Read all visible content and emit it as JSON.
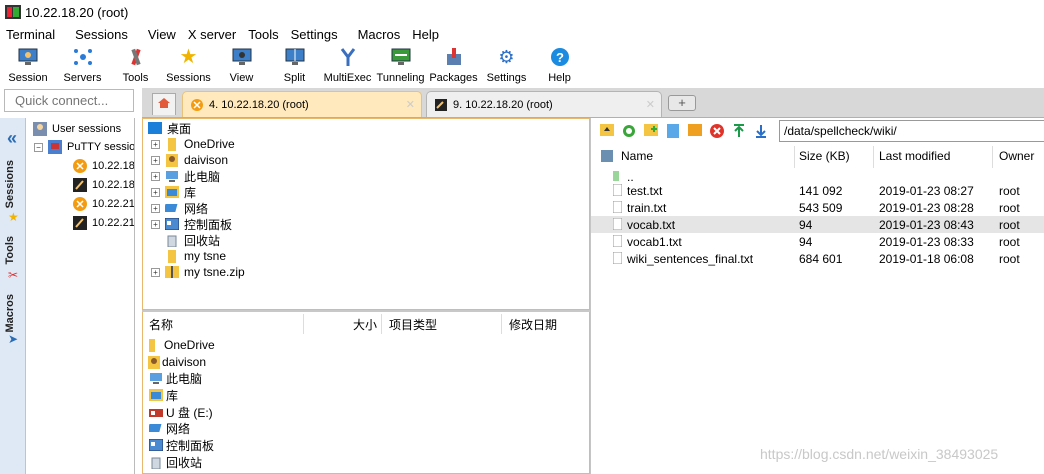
{
  "window": {
    "title": "10.22.18.20 (root)"
  },
  "menu": [
    "Terminal",
    "Sessions",
    "View",
    "X server",
    "Tools",
    "Settings",
    "Macros",
    "Help"
  ],
  "toolbar": [
    {
      "label": "Session",
      "icon": "monitor-session-icon"
    },
    {
      "label": "Servers",
      "icon": "servers-icon"
    },
    {
      "label": "Tools",
      "icon": "tools-icon"
    },
    {
      "label": "Sessions",
      "icon": "star-icon"
    },
    {
      "label": "View",
      "icon": "view-icon"
    },
    {
      "label": "Split",
      "icon": "split-icon"
    },
    {
      "label": "MultiExec",
      "icon": "fork-icon"
    },
    {
      "label": "Tunneling",
      "icon": "tunneling-icon"
    },
    {
      "label": "Packages",
      "icon": "packages-icon"
    },
    {
      "label": "Settings",
      "icon": "gear-icon"
    },
    {
      "label": "Help",
      "icon": "help-icon"
    }
  ],
  "quick_connect": {
    "placeholder": "Quick connect..."
  },
  "tabs": [
    {
      "label": "4. 10.22.18.20 (root)",
      "active": true
    },
    {
      "label": "9. 10.22.18.20 (root)",
      "active": false
    }
  ],
  "sidebar": {
    "sessions_label": "Sessions",
    "tools_label": "Tools",
    "macros_label": "Macros"
  },
  "sessions_panel": {
    "root": "User sessions",
    "group": "PuTTY sessio",
    "items": [
      "10.22.18",
      "10.22.18",
      "10.22.21",
      "10.22.21"
    ]
  },
  "local_tree": {
    "root": "桌面",
    "items": [
      {
        "label": "OneDrive",
        "expander": "+"
      },
      {
        "label": "daivison",
        "expander": "+"
      },
      {
        "label": "此电脑",
        "expander": "+"
      },
      {
        "label": "库",
        "expander": "+"
      },
      {
        "label": "网络",
        "expander": "+"
      },
      {
        "label": "控制面板",
        "expander": "+"
      },
      {
        "label": "回收站",
        "expander": ""
      },
      {
        "label": "my tsne",
        "expander": ""
      },
      {
        "label": "my tsne.zip",
        "expander": "+"
      }
    ]
  },
  "local_list": {
    "headers": [
      "名称",
      "大小",
      "项目类型",
      "修改日期"
    ],
    "rows": [
      "OneDrive",
      "daivison",
      "此电脑",
      "库",
      "U 盘 (E:)",
      "网络",
      "控制面板",
      "回收站"
    ]
  },
  "remote": {
    "path": "/data/spellcheck/wiki/",
    "headers": [
      "Name",
      "Size (KB)",
      "Last modified",
      "Owner"
    ],
    "parent": "..",
    "files": [
      {
        "name": "test.txt",
        "size": "141 092",
        "modified": "2019-01-23 08:27",
        "owner": "root",
        "selected": false
      },
      {
        "name": "train.txt",
        "size": "543 509",
        "modified": "2019-01-23 08:28",
        "owner": "root",
        "selected": false
      },
      {
        "name": "vocab.txt",
        "size": "94",
        "modified": "2019-01-23 08:43",
        "owner": "root",
        "selected": true
      },
      {
        "name": "vocab1.txt",
        "size": "94",
        "modified": "2019-01-23 08:33",
        "owner": "root",
        "selected": false
      },
      {
        "name": "wiki_sentences_final.txt",
        "size": "684 601",
        "modified": "2019-01-18 06:08",
        "owner": "root",
        "selected": false
      }
    ]
  },
  "watermark": "https://blog.csdn.net/weixin_38493025"
}
